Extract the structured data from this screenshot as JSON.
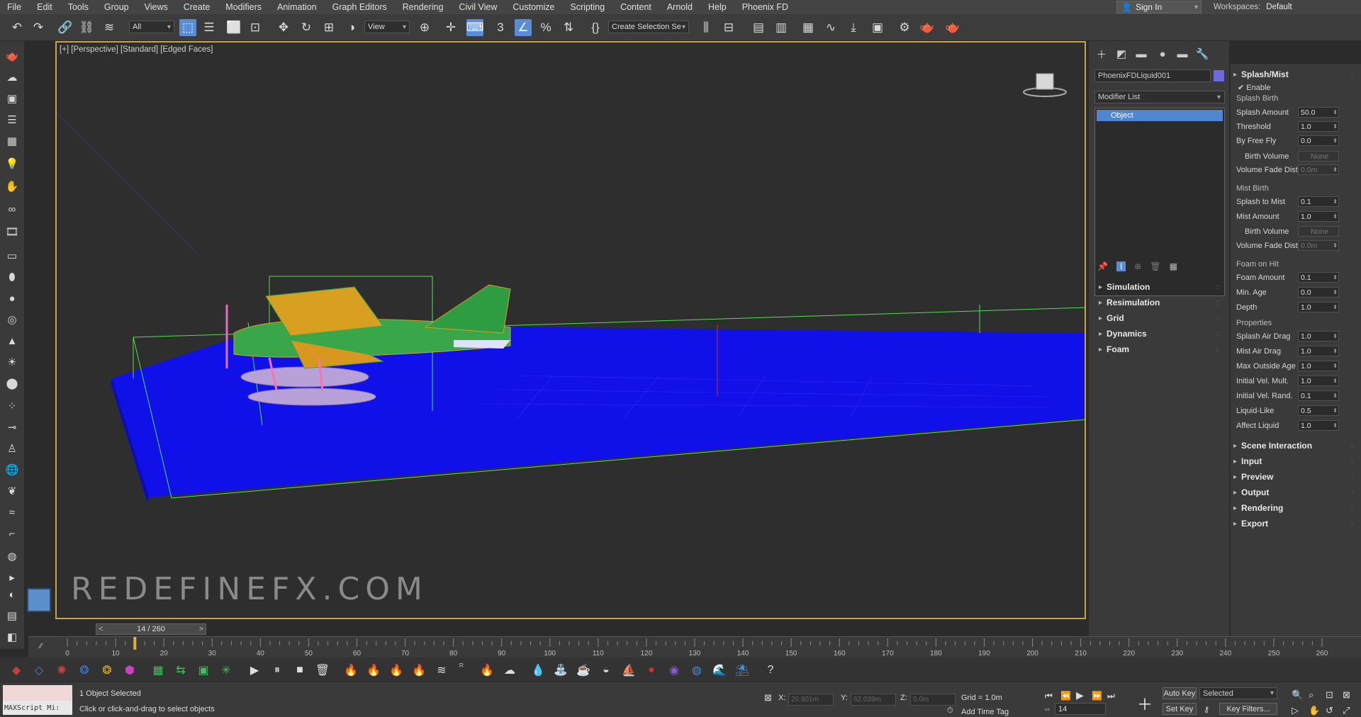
{
  "menu": [
    "File",
    "Edit",
    "Tools",
    "Group",
    "Views",
    "Create",
    "Modifiers",
    "Animation",
    "Graph Editors",
    "Rendering",
    "Civil View",
    "Customize",
    "Scripting",
    "Content",
    "Arnold",
    "Help",
    "Phoenix FD"
  ],
  "signin_label": "Sign In",
  "workspaces_label": "Workspaces:",
  "workspaces_value": "Default",
  "toolbar": {
    "filter_value": "All",
    "refcoord_value": "View",
    "selection_set_placeholder": "Create Selection Se"
  },
  "viewport": {
    "label": "[+] [Perspective] [Standard] [Edged Faces]",
    "watermark_text": "REDEFINEFX.COM"
  },
  "cmdpanel": {
    "object_name": "PhoenixFDLiquid001",
    "object_color": "#6a6ad8",
    "modifier_list": "Modifier List",
    "stack_item": "Object",
    "sections": [
      "Simulation",
      "Resimulation",
      "Grid",
      "Dynamics",
      "Foam"
    ]
  },
  "rollout": {
    "title": "Splash/Mist",
    "enable_label": "Enable",
    "splash_birth_header": "Splash Birth",
    "splash_amount_label": "Splash Amount",
    "splash_amount": "50.0",
    "threshold_label": "Threshold",
    "threshold": "1.0",
    "by_free_fly_label": "By Free Fly",
    "by_free_fly": "0.0",
    "birth_volume_label": "Birth Volume",
    "birth_volume": "None",
    "volume_fade_dist_label": "Volume Fade Dist",
    "volume_fade_dist": "0.0m",
    "mist_birth_header": "Mist Birth",
    "splash_to_mist_label": "Splash to Mist",
    "splash_to_mist": "0.1",
    "mist_amount_label": "Mist Amount",
    "mist_amount": "1.0",
    "mist_birth_volume_label": "Birth Volume",
    "mist_birth_volume": "None",
    "mist_volume_fade_dist_label": "Volume Fade Dist",
    "mist_volume_fade_dist": "0.0m",
    "foam_on_hit_header": "Foam on Hit",
    "foam_amount_label": "Foam Amount",
    "foam_amount": "0.1",
    "min_age_label": "Min. Age",
    "min_age": "0.0",
    "depth_label": "Depth",
    "depth": "1.0",
    "properties_header": "Properties",
    "splash_air_drag_label": "Splash Air Drag",
    "splash_air_drag": "1.0",
    "mist_air_drag_label": "Mist Air Drag",
    "mist_air_drag": "1.0",
    "max_outside_age_label": "Max Outside Age",
    "max_outside_age": "1.0",
    "initial_vel_mult_label": "Initial Vel. Mult.",
    "initial_vel_mult": "1.0",
    "initial_vel_rand_label": "Initial Vel. Rand.",
    "initial_vel_rand": "0.1",
    "liquid_like_label": "Liquid-Like",
    "liquid_like": "0.5",
    "affect_liquid_label": "Affect Liquid",
    "affect_liquid": "1.0",
    "sections": [
      "Scene Interaction",
      "Input",
      "Preview",
      "Output",
      "Rendering",
      "Export"
    ]
  },
  "timeline": {
    "frame_display": "14 / 260",
    "prev": "<",
    "next": ">",
    "current_frame": 14,
    "total_frames": 260,
    "ticks": [
      "0",
      "10",
      "20",
      "30",
      "40",
      "50",
      "60",
      "70",
      "80",
      "90",
      "100",
      "110",
      "120",
      "130",
      "140",
      "150",
      "160",
      "170",
      "180",
      "190",
      "200",
      "210",
      "220",
      "230",
      "240",
      "250",
      "260"
    ]
  },
  "status": {
    "maxscript_label": "MAXScript Mi:",
    "selection_count": "1 Object Selected",
    "prompt": "Click or click-and-drag to select objects",
    "x_label": "X:",
    "x_value": "20.901m",
    "y_label": "Y:",
    "y_value": "62.039m",
    "z_label": "Z:",
    "z_value": "0.0m",
    "grid": "Grid = 1.0m",
    "add_time_tag": "Add Time Tag",
    "auto_key": "Auto Key",
    "set_key": "Set Key",
    "selected_dropdown": "Selected",
    "key_filters": "Key Filters...",
    "frame_field": "14"
  },
  "colors": {
    "water": "#1010e8",
    "selection_box": "#52e052",
    "active_viewport_border": "#c8a34a",
    "accent": "#5b8dd6"
  }
}
